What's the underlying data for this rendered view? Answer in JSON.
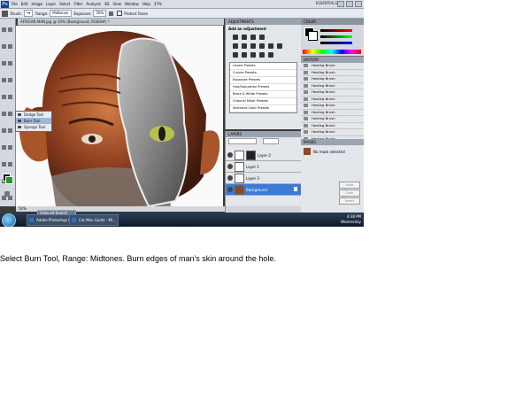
{
  "menubar": {
    "logo": "Ps",
    "items": [
      "File",
      "Edit",
      "Image",
      "Layer",
      "Select",
      "Filter",
      "Analysis",
      "3D",
      "View",
      "Window",
      "Help"
    ],
    "zoom": "37%",
    "workspace": "ESSENTIALS"
  },
  "options": {
    "tool": "Brush:",
    "range_label": "Range:",
    "range_value": "Midtones",
    "exposure_label": "Exposure:",
    "exposure_value": "50%",
    "protect_tones": "Protect Tones"
  },
  "document": {
    "tab": "AFRICAN MAN.jpg @ 50% (Background, RGB/8#) *",
    "status_zoom": "50%"
  },
  "tool_flyout": {
    "items": [
      "Dodge Tool",
      "Burn Tool",
      "Sponge Tool"
    ],
    "selected": "Burn Tool"
  },
  "adjustments": {
    "title": "ADJUSTMENTS",
    "subtitle": "Add an adjustment",
    "presets": [
      "Levels Presets",
      "Curves Presets",
      "Exposure Presets",
      "Hue/Saturation Presets",
      "Black & White Presets",
      "Channel Mixer Presets",
      "Selective Color Presets"
    ]
  },
  "layers": {
    "title": "LAYERS",
    "rows": [
      "Layer 2",
      "Layer 1",
      "Layer 3",
      "Background"
    ],
    "selected": "Background"
  },
  "history": {
    "title": "HISTORY",
    "items": [
      "Healing Brush",
      "Healing Brush",
      "Healing Brush",
      "Healing Brush",
      "Healing Brush",
      "Healing Brush",
      "Healing Brush",
      "Healing Brush",
      "Healing Brush",
      "Healing Brush",
      "Healing Brush",
      "Healing Brush",
      "Healing Brush",
      "Healing Brush",
      "Healing Brush"
    ]
  },
  "masks": {
    "title": "MASKS",
    "label": "No mask selected",
    "buttons": [
      "Mask Edge...",
      "Color Range...",
      "Invert"
    ]
  },
  "taskbar": {
    "items": [
      "Adobe Photoshop C...",
      "Cat Man Guide - Mi..."
    ],
    "tray_time": "4:38 PM",
    "tray_day": "Wednesday",
    "search": "Vista-ed Search"
  },
  "caption": "Select Burn Tool, Range: Midtones.  Burn edges of man’s skin around the hole.",
  "colors": {
    "accent": "#3d7ad6",
    "taskbar": "#1a2638",
    "panel": "#e3e6ea"
  }
}
